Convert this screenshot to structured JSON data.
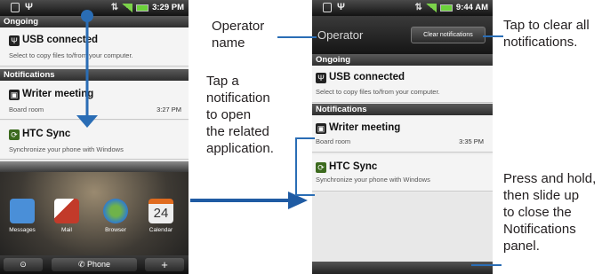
{
  "phone1": {
    "status_time": "3:29 PM",
    "ongoing_header": "Ongoing",
    "usb": {
      "title": "USB connected",
      "subtitle": "Select to copy files to/from your computer."
    },
    "notifications_header": "Notifications",
    "writer": {
      "title": "Writer meeting",
      "subtitle": "Board room",
      "time": "3:27 PM"
    },
    "htc": {
      "title": "HTC Sync",
      "subtitle": "Synchronize your phone with Windows"
    },
    "apps": [
      {
        "label": "Messages",
        "color": "#4a8fd8"
      },
      {
        "label": "Mail",
        "color": "#c23a2a"
      },
      {
        "label": "Browser",
        "color": "#2e7bd1"
      },
      {
        "label": "Calendar",
        "color": "#e8e8e8",
        "day": "24"
      }
    ],
    "dock": {
      "phone_label": "Phone",
      "plus": "+",
      "left_icon": "⊙"
    }
  },
  "phone2": {
    "status_time": "9:44 AM",
    "operator": "Operator",
    "clear_button": "Clear notifications",
    "ongoing_header": "Ongoing",
    "usb": {
      "title": "USB connected",
      "subtitle": "Select to copy files to/from your computer."
    },
    "notifications_header": "Notifications",
    "writer": {
      "title": "Writer meeting",
      "subtitle": "Board room",
      "time": "3:35 PM"
    },
    "htc": {
      "title": "HTC Sync",
      "subtitle": "Synchronize your phone with Windows"
    }
  },
  "callouts": {
    "operator_name_1": "Operator",
    "operator_name_2": "name",
    "tap_notification": [
      "Tap a",
      "notification",
      "to open",
      "the related",
      "application."
    ],
    "tap_clear": [
      "Tap to clear all",
      "notifications."
    ],
    "press_hold": [
      "Press and hold,",
      "then slide up",
      "to close the",
      "Notifications",
      "panel."
    ]
  },
  "colors": {
    "accent_blue": "#2a6db5",
    "header_dark": "#2e2e2e"
  }
}
